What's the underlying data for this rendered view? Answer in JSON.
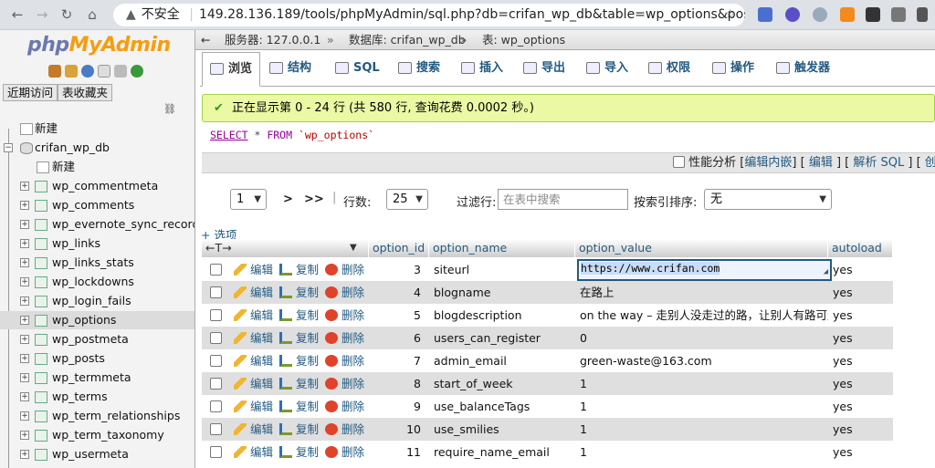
{
  "browser": {
    "security_label": "不安全",
    "url": "149.28.136.189/tools/phpMyAdmin/sql.php?db=crifan_wp_db&table=wp_options&pos=0"
  },
  "sidebar": {
    "logo_php": "php",
    "logo_rest": "MyAdmin",
    "tabs": [
      "近期访问",
      "表收藏夹"
    ],
    "new_root": "新建",
    "db_name": "crifan_wp_db",
    "db_new": "新建",
    "tables": [
      "wp_commentmeta",
      "wp_comments",
      "wp_evernote_sync_record",
      "wp_links",
      "wp_links_stats",
      "wp_lockdowns",
      "wp_login_fails",
      "wp_options",
      "wp_postmeta",
      "wp_posts",
      "wp_termmeta",
      "wp_terms",
      "wp_term_relationships",
      "wp_term_taxonomy",
      "wp_usermeta"
    ],
    "selected_table": "wp_options"
  },
  "breadcrumb": {
    "server": "服务器: 127.0.0.1",
    "database": "数据库: crifan_wp_db",
    "table": "表: wp_options"
  },
  "tabs": [
    "浏览",
    "结构",
    "SQL",
    "搜索",
    "插入",
    "导出",
    "导入",
    "权限",
    "操作",
    "触发器"
  ],
  "success_message": "正在显示第 0 - 24 行 (共 580 行, 查询花费 0.0002 秒。)",
  "sql": {
    "select": "SELECT",
    "rest": " * ",
    "from": "FROM",
    "table": " `wp_options`"
  },
  "profiling": {
    "label": "性能分析",
    "inline_edit": "编辑内嵌",
    "edit": "编辑",
    "explain": "解析 SQL",
    "create": "创建 P"
  },
  "nav": {
    "page": "1",
    "next": ">",
    "last": ">>",
    "rows_label": "行数:",
    "rows_value": "25",
    "filter_label": "过滤行:",
    "filter_placeholder": "在表中搜索",
    "sort_label": "按索引排序:",
    "sort_value": "无"
  },
  "options_link": "+ 选项",
  "grid": {
    "columns": [
      "option_id",
      "option_name",
      "option_value",
      "autoload"
    ],
    "actions": {
      "edit": "编辑",
      "copy": "复制",
      "delete": "删除"
    },
    "rows": [
      {
        "id": "3",
        "name": "siteurl",
        "value": "https://www.crifan.com",
        "autoload": "yes"
      },
      {
        "id": "4",
        "name": "blogname",
        "value": "在路上",
        "autoload": "yes"
      },
      {
        "id": "5",
        "name": "blogdescription",
        "value": "on the way – 走别人没走过的路，让别人有路可走",
        "autoload": "yes"
      },
      {
        "id": "6",
        "name": "users_can_register",
        "value": "0",
        "autoload": "yes"
      },
      {
        "id": "7",
        "name": "admin_email",
        "value": "green-waste@163.com",
        "autoload": "yes"
      },
      {
        "id": "8",
        "name": "start_of_week",
        "value": "1",
        "autoload": "yes"
      },
      {
        "id": "9",
        "name": "use_balanceTags",
        "value": "1",
        "autoload": "yes"
      },
      {
        "id": "10",
        "name": "use_smilies",
        "value": "1",
        "autoload": "yes"
      },
      {
        "id": "11",
        "name": "require_name_email",
        "value": "1",
        "autoload": "yes"
      }
    ]
  },
  "colors": {
    "link": "#235a81",
    "success_bg": "#ebf8a4",
    "row_alt": "#dfdfdf"
  }
}
